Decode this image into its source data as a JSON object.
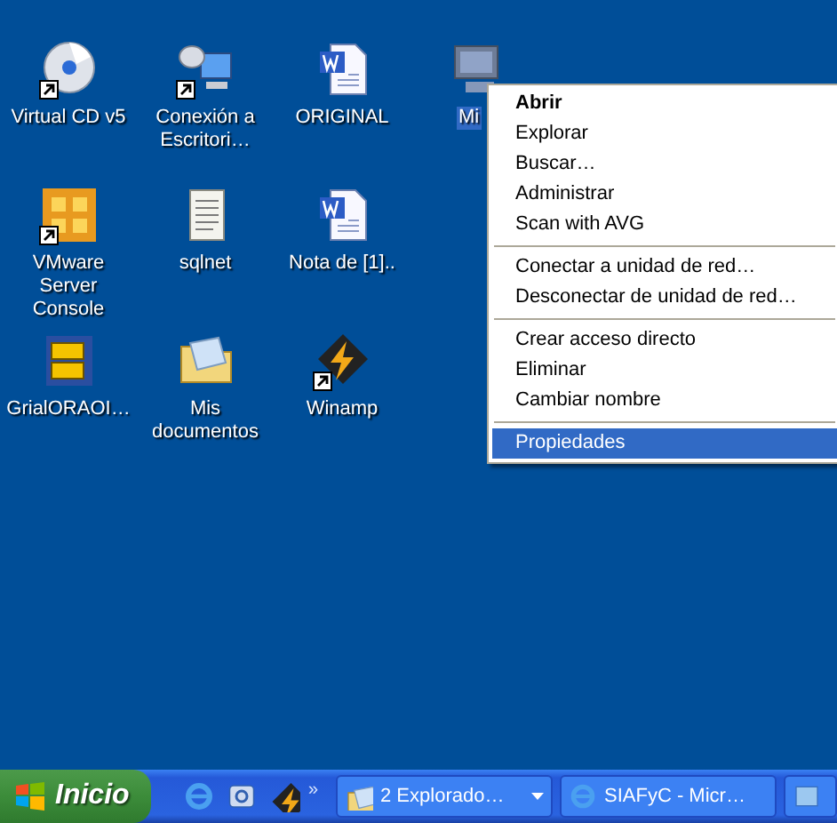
{
  "desktop": {
    "columns": [
      [
        {
          "label": "Virtual CD v5",
          "kind": "cd",
          "shortcut": true,
          "selected": false
        },
        {
          "label": "VMware Server Console",
          "kind": "vmware",
          "shortcut": true,
          "selected": false
        },
        {
          "label": "GrialORAOI…",
          "kind": "cabinet",
          "shortcut": false,
          "selected": false
        }
      ],
      [
        {
          "label": "Conexión a Escritori…",
          "kind": "remote",
          "shortcut": true,
          "selected": false
        },
        {
          "label": "sqlnet",
          "kind": "notepad",
          "shortcut": false,
          "selected": false
        },
        {
          "label": "Mis documentos",
          "kind": "folder",
          "shortcut": false,
          "selected": false
        }
      ],
      [
        {
          "label": "ORIGINAL",
          "kind": "word",
          "shortcut": false,
          "selected": false
        },
        {
          "label": "Nota de  [1]..",
          "kind": "word",
          "shortcut": false,
          "selected": false
        },
        {
          "label": "Winamp",
          "kind": "winamp",
          "shortcut": true,
          "selected": false
        }
      ],
      [
        {
          "label": "Mi",
          "kind": "computer",
          "shortcut": false,
          "selected": true
        }
      ]
    ]
  },
  "context_menu": [
    {
      "kind": "item",
      "label": "Abrir",
      "default": true,
      "selected": false
    },
    {
      "kind": "item",
      "label": "Explorar",
      "default": false,
      "selected": false
    },
    {
      "kind": "item",
      "label": "Buscar…",
      "default": false,
      "selected": false
    },
    {
      "kind": "item",
      "label": "Administrar",
      "default": false,
      "selected": false
    },
    {
      "kind": "item",
      "label": "Scan with AVG",
      "default": false,
      "selected": false
    },
    {
      "kind": "separator"
    },
    {
      "kind": "item",
      "label": "Conectar a unidad de red…",
      "default": false,
      "selected": false
    },
    {
      "kind": "item",
      "label": "Desconectar de unidad de red…",
      "default": false,
      "selected": false
    },
    {
      "kind": "separator"
    },
    {
      "kind": "item",
      "label": "Crear acceso directo",
      "default": false,
      "selected": false
    },
    {
      "kind": "item",
      "label": "Eliminar",
      "default": false,
      "selected": false
    },
    {
      "kind": "item",
      "label": "Cambiar nombre",
      "default": false,
      "selected": false
    },
    {
      "kind": "separator"
    },
    {
      "kind": "item",
      "label": "Propiedades",
      "default": false,
      "selected": true
    }
  ],
  "taskbar": {
    "start_label": "Inicio",
    "quick_launch": [
      {
        "kind": "ie"
      },
      {
        "kind": "mail"
      },
      {
        "kind": "winamp"
      }
    ],
    "chevron": "»",
    "tasks": [
      {
        "label": "2 Explorado…",
        "kind": "folder",
        "dropdown": true
      },
      {
        "label": "SIAFyC - Micr…",
        "kind": "ie",
        "dropdown": false
      },
      {
        "kind": "window",
        "dropdown": false
      }
    ]
  }
}
